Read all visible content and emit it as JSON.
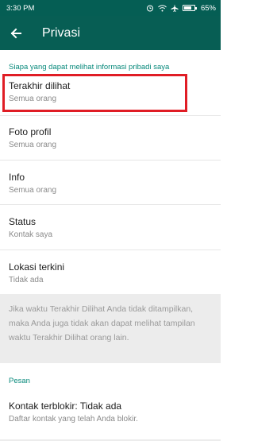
{
  "status_bar": {
    "time": "3:30 PM",
    "battery": "65%",
    "battery_level": 0.65
  },
  "toolbar": {
    "title": "Privasi",
    "back_icon": "arrow-left-icon"
  },
  "section_personal": {
    "header": "Siapa yang dapat melihat informasi pribadi saya",
    "items": [
      {
        "title": "Terakhir dilihat",
        "subtitle": "Semua orang"
      },
      {
        "title": "Foto profil",
        "subtitle": "Semua orang"
      },
      {
        "title": "Info",
        "subtitle": "Semua orang"
      },
      {
        "title": "Status",
        "subtitle": "Kontak saya"
      },
      {
        "title": "Lokasi terkini",
        "subtitle": "Tidak ada"
      }
    ]
  },
  "info_note": "Jika waktu Terakhir Dilihat Anda tidak ditampilkan, maka Anda juga tidak akan dapat melihat tampilan waktu Terakhir Dilihat orang lain.",
  "section_messages": {
    "header": "Pesan",
    "items": [
      {
        "title": "Kontak terblokir: Tidak ada",
        "subtitle": "Daftar kontak yang telah Anda blokir."
      }
    ]
  },
  "colors": {
    "toolbar": "#075e54",
    "statusbar": "#055e54",
    "accent": "#07897b",
    "highlight": "#e01d25"
  }
}
